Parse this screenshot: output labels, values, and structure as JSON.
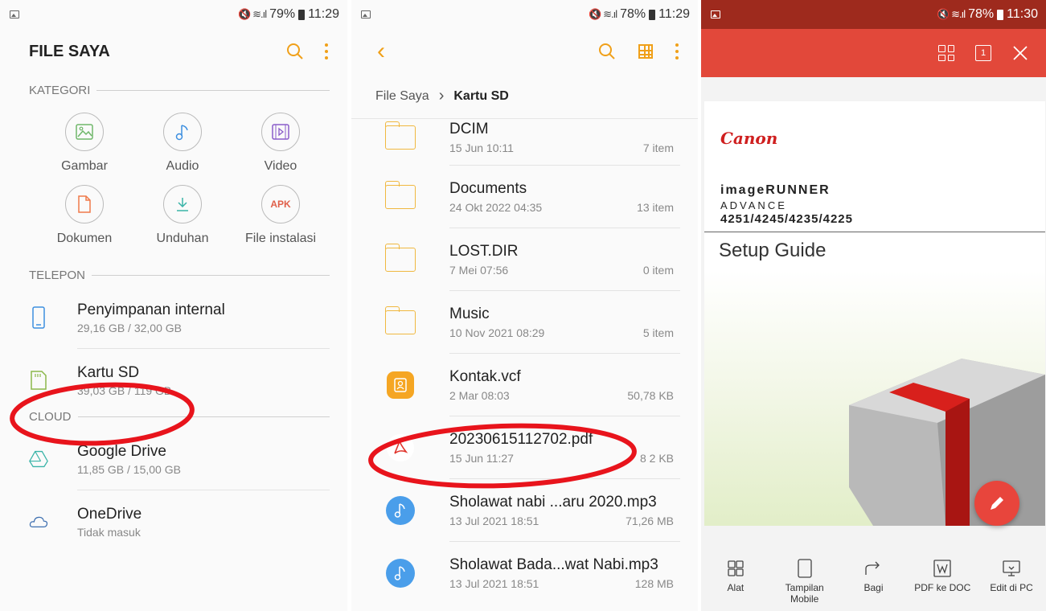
{
  "panel1": {
    "status": {
      "battery": "79%",
      "time": "11:29"
    },
    "title": "FILE SAYA",
    "kategori_label": "KATEGORI",
    "categories": [
      {
        "label": "Gambar",
        "icon": "image-icon",
        "color": "#6fb76a"
      },
      {
        "label": "Audio",
        "icon": "music-note-icon",
        "color": "#3d8fe0"
      },
      {
        "label": "Video",
        "icon": "video-icon",
        "color": "#8a5cc9"
      },
      {
        "label": "Dokumen",
        "icon": "document-icon",
        "color": "#f07a4a"
      },
      {
        "label": "Unduhan",
        "icon": "download-icon",
        "color": "#3ab4a8"
      },
      {
        "label": "File instalasi",
        "icon": "apk-icon",
        "apk_text": "APK",
        "color": "#e0604a"
      }
    ],
    "telepon_label": "TELEPON",
    "telepon": [
      {
        "name": "Penyimpanan internal",
        "size": "29,16 GB / 32,00 GB",
        "icon": "phone-icon"
      },
      {
        "name": "Kartu SD",
        "size": "39,03 GB / 119 GB",
        "icon": "sd-card-icon"
      }
    ],
    "cloud_label": "CLOUD",
    "cloud": [
      {
        "name": "Google Drive",
        "size": "11,85 GB / 15,00 GB",
        "icon": "google-drive-icon"
      },
      {
        "name": "OneDrive",
        "size": "Tidak masuk",
        "icon": "onedrive-icon"
      }
    ]
  },
  "panel2": {
    "status": {
      "battery": "78%",
      "time": "11:29"
    },
    "breadcrumb": {
      "root": "File Saya",
      "current": "Kartu SD"
    },
    "files": [
      {
        "name": "DCIM",
        "date": "15 Jun 10:11",
        "info": "7 item",
        "type": "folder"
      },
      {
        "name": "Documents",
        "date": "24 Okt 2022 04:35",
        "info": "13 item",
        "type": "folder"
      },
      {
        "name": "LOST.DIR",
        "date": "7 Mei 07:56",
        "info": "0 item",
        "type": "folder"
      },
      {
        "name": "Music",
        "date": "10 Nov 2021 08:29",
        "info": "5 item",
        "type": "folder"
      },
      {
        "name": "Kontak.vcf",
        "date": "2 Mar 08:03",
        "info": "50,78 KB",
        "type": "contact"
      },
      {
        "name": "20230615112702.pdf",
        "date": "15 Jun 11:27",
        "info": "8 2 KB",
        "type": "pdf"
      },
      {
        "name": "Sholawat nabi ...aru 2020.mp3",
        "date": "13 Jul 2021 18:51",
        "info": "71,26 MB",
        "type": "audio"
      },
      {
        "name": "Sholawat Bada...wat Nabi.mp3",
        "date": "13 Jul 2021 18:51",
        "info": "128 MB",
        "type": "audio"
      }
    ]
  },
  "panel3": {
    "status": {
      "battery": "78%",
      "time": "11:30"
    },
    "page_indicator": "1",
    "document": {
      "brand": "Canon",
      "model_line1": "imageRUNNER",
      "model_line2": "ADVANCE",
      "model_line3": "4251/4245/4235/4225",
      "heading": "Setup Guide"
    },
    "toolbar": [
      {
        "label": "Alat",
        "icon": "tools-icon"
      },
      {
        "label": "Tampilan Mobile",
        "icon": "mobile-view-icon"
      },
      {
        "label": "Bagi",
        "icon": "share-icon"
      },
      {
        "label": "PDF ke DOC",
        "icon": "pdf-to-doc-icon"
      },
      {
        "label": "Edit di PC",
        "icon": "edit-on-pc-icon"
      }
    ]
  },
  "colors": {
    "accent_orange": "#f0a019",
    "red_toolbar": "#e2483a",
    "highlight_ring": "#e8141c"
  }
}
